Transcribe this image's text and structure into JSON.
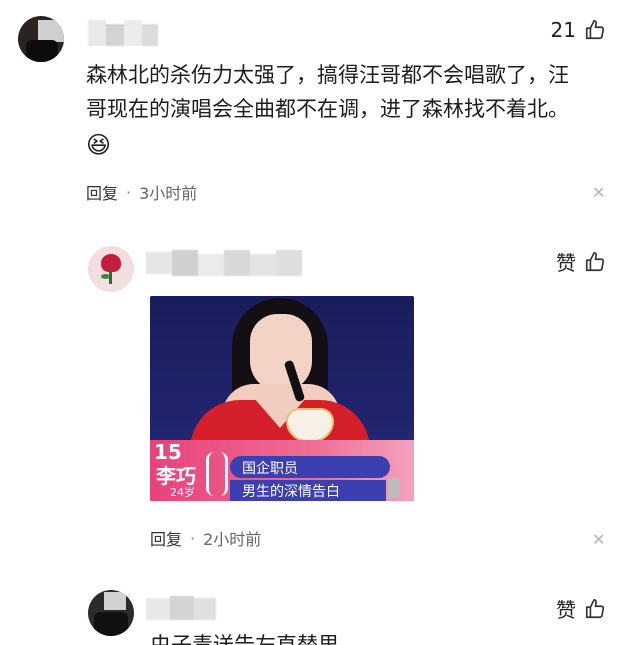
{
  "comments": [
    {
      "text_line1": "森林北的杀伤力太强了，搞得汪哥都不会唱歌了，汪",
      "text_line2": "哥现在的演唱会全曲都不在调，进了森林找不着北。",
      "emoji": "😆",
      "likes": "21",
      "reply_label": "回复",
      "time": "3小时前"
    },
    {
      "likes_label": "赞",
      "reply_label": "回复",
      "time": "2小时前",
      "image": {
        "badge_number": "15",
        "badge_name": "李巧",
        "badge_age": "24岁",
        "caption_top": "国企职员",
        "caption_bottom": "男生的深情告白"
      }
    },
    {
      "likes_label": "赞",
      "partial_text": "虫子毒送告左直替里"
    }
  ],
  "colors": {
    "close": "#b6b6b6",
    "banner_pink": "#e8427a",
    "caption_blue": "#3b3fb0"
  }
}
